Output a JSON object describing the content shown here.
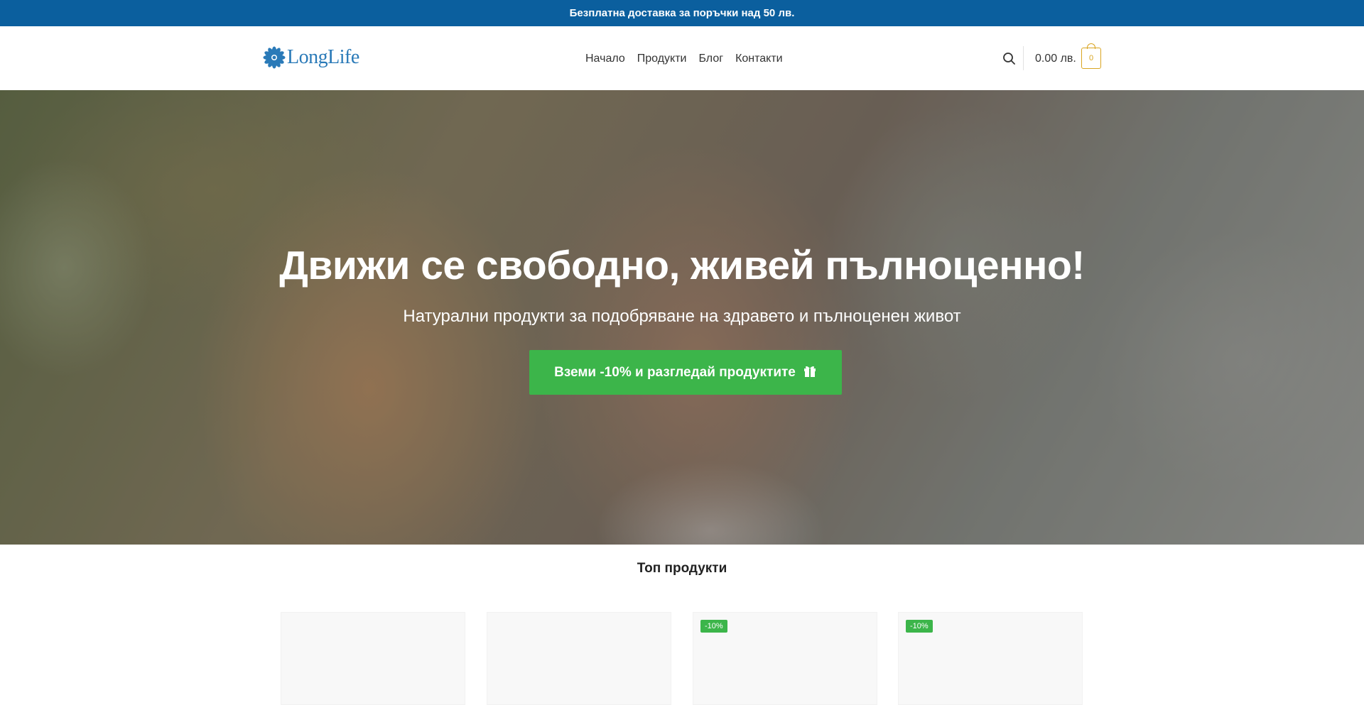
{
  "topbar": {
    "text": "Безплатна доставка за поръчки над 50 лв."
  },
  "brand": {
    "name_light": "Long",
    "name_bold": "Life",
    "logo_icon": "flower-icon",
    "color": "#2a7ab8"
  },
  "nav": {
    "items": [
      {
        "label": "Начало"
      },
      {
        "label": "Продукти"
      },
      {
        "label": "Блог"
      },
      {
        "label": "Контакти"
      }
    ]
  },
  "header_actions": {
    "search_icon": "search-icon",
    "cart_total": "0.00 лв.",
    "cart_count": "0",
    "cart_icon": "shopping-bag-icon"
  },
  "hero": {
    "title": "Движи се свободно, живей пълноценно!",
    "subtitle": "Натурални продукти за подобряване на здравето и пълноценен живот",
    "cta_label": "Вземи -10% и разгледай продуктите",
    "cta_icon": "gift-icon",
    "cta_color": "#3cb54a"
  },
  "products_section": {
    "title": "Топ продукти",
    "cards": [
      {
        "badge": ""
      },
      {
        "badge": ""
      },
      {
        "badge": "-10%"
      },
      {
        "badge": "-10%"
      }
    ]
  },
  "colors": {
    "topbar": "#0b5f9e",
    "accent_green": "#3cb54a",
    "cart_gold": "#d9a521"
  }
}
